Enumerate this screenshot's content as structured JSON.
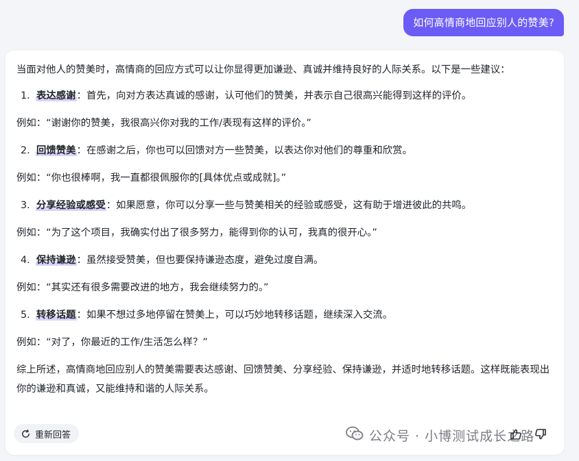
{
  "user_message": "如何高情商地回应别人的赞美?",
  "answer": {
    "intro": "当面对他人的赞美时，高情商的回应方式可以让你显得更加谦逊、真诚并维持良好的人际关系。以下是一些建议：",
    "items": [
      {
        "number": "1.",
        "keyword": "表达感谢",
        "text": "：首先，向对方表达真诚的感谢，认可他们的赞美，并表示自己很高兴能得到这样的评价。",
        "example": "例如：“谢谢你的赞美，我很高兴你对我的工作/表现有这样的评价。”"
      },
      {
        "number": "2.",
        "keyword": "回馈赞美",
        "text": "：在感谢之后，你也可以回馈对方一些赞美，以表达你对他们的尊重和欣赏。",
        "example": "例如：“你也很棒啊，我一直都很佩服你的[具体优点或成就]。”"
      },
      {
        "number": "3.",
        "keyword": "分享经验或感受",
        "text": "：如果愿意，你可以分享一些与赞美相关的经验或感受，这有助于增进彼此的共鸣。",
        "example": "例如：“为了这个项目，我确实付出了很多努力，能得到你的认可，我真的很开心。”"
      },
      {
        "number": "4.",
        "keyword": "保持谦逊",
        "text": "：虽然接受赞美，但也要保持谦逊态度，避免过度自满。",
        "example": "例如：“其实还有很多需要改进的地方，我会继续努力的。”"
      },
      {
        "number": "5.",
        "keyword": "转移话题",
        "text": "：如果不想过多地停留在赞美上，可以巧妙地转移话题，继续深入交流。",
        "example": "例如：“对了，你最近的工作/生活怎么样？”"
      }
    ],
    "summary": "综上所述，高情商地回应别人的赞美需要表达感谢、回馈赞美、分享经验、保持谦逊，并适时地转移话题。这样既能表现出你的谦逊和真诚，又能维持和谐的人际关系。"
  },
  "actions": {
    "regenerate_label": "重新回答",
    "regenerate_icon": "refresh-icon",
    "thumbs_up_icon": "thumbs-up-icon",
    "thumbs_down_icon": "thumbs-down-icon"
  },
  "watermark": {
    "text": "公众号 · 小博测试成长之路",
    "icon": "wechat-icon"
  },
  "colors": {
    "accent": "#6b5cf6",
    "highlight": "#d9d3fb",
    "card_bg": "#ffffff",
    "page_bg": "#f4f5f8"
  }
}
